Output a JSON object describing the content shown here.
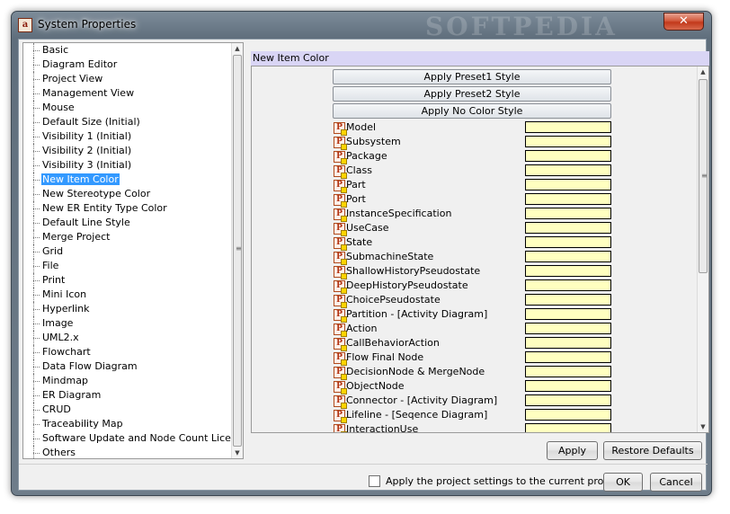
{
  "window": {
    "title": "System Properties",
    "app_icon": "ast-app-icon",
    "watermark": "SOFTPEDIA",
    "close_label": "✕"
  },
  "tree": {
    "selected_index": 9,
    "items": [
      "Basic",
      "Diagram Editor",
      "Project View",
      "Management View",
      "Mouse",
      "Default Size (Initial)",
      "Visibility 1 (Initial)",
      "Visibility 2 (Initial)",
      "Visibility 3 (Initial)",
      "New Item Color",
      "New Stereotype Color",
      "New ER Entity Type Color",
      "Default Line Style",
      "Merge Project",
      "Grid",
      "File",
      "Print",
      "Mini Icon",
      "Hyperlink",
      "Image",
      "UML2.x",
      "Flowchart",
      "Data Flow Diagram",
      "Mindmap",
      "ER Diagram",
      "CRUD",
      "Traceability Map",
      "Software Update and Node Count License",
      "Others"
    ]
  },
  "panel": {
    "header": "New Item Color",
    "preset_buttons": [
      "Apply Preset1 Style",
      "Apply Preset2 Style",
      "Apply No Color Style"
    ],
    "swatch_color": "#ffffc0",
    "rows": [
      "Model",
      "Subsystem",
      "Package",
      "Class",
      "Part",
      "Port",
      "InstanceSpecification",
      "UseCase",
      "State",
      "SubmachineState",
      "ShallowHistoryPseudostate",
      "DeepHistoryPseudostate",
      "ChoicePseudostate",
      "Partition - [Activity Diagram]",
      "Action",
      "CallBehaviorAction",
      "Flow Final Node",
      "DecisionNode & MergeNode",
      "ObjectNode",
      "Connector - [Activity Diagram]",
      "Lifeline - [Seqence Diagram]",
      "InteractionUse"
    ],
    "apply_label": "Apply",
    "restore_label": "Restore Defaults"
  },
  "footer": {
    "checkbox_label": "Apply the project settings to the current project",
    "checkbox_checked": false,
    "ok_label": "OK",
    "cancel_label": "Cancel"
  },
  "icons": {
    "row_icon": "p-property-icon",
    "scroll_up": "▲",
    "scroll_down": "▼",
    "grip": "≡"
  },
  "colors": {
    "selection": "#3399ff",
    "header_bg": "#d9d5f5",
    "close_button": "#c2381b"
  }
}
